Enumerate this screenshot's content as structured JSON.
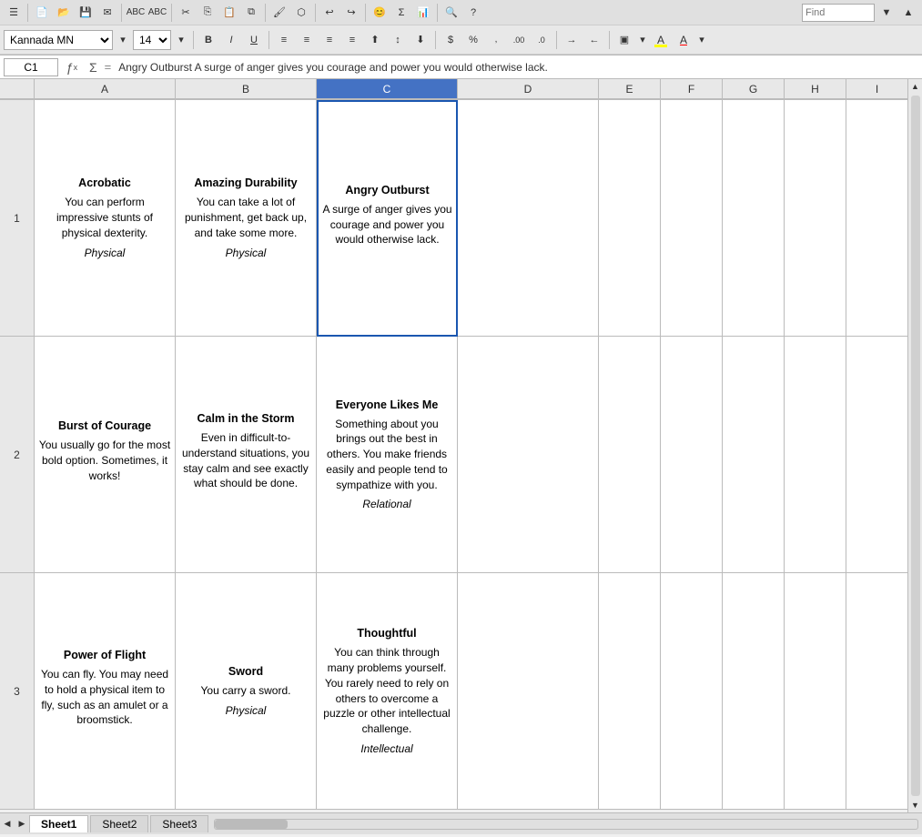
{
  "toolbar": {
    "font_name": "Kannada MN",
    "font_size": "14",
    "bold_label": "B",
    "italic_label": "I",
    "underline_label": "U",
    "find_placeholder": "Find"
  },
  "formula_bar": {
    "cell_ref": "C1",
    "formula_text": "Angry Outburst  A surge of anger gives you courage and power you would otherwise lack."
  },
  "columns": [
    "A",
    "B",
    "C",
    "D",
    "E",
    "F",
    "G",
    "H",
    "I"
  ],
  "rows": [
    {
      "row_num": "1",
      "cells": [
        {
          "title": "Acrobatic",
          "body": "You can perform impressive stunts of physical dexterity.",
          "type": "Physical"
        },
        {
          "title": "Amazing Durability",
          "body": "You can take a lot of punishment, get back up, and take some more.",
          "type": "Physical"
        },
        {
          "title": "Angry Outburst",
          "body": "A surge of anger gives you courage and power you would otherwise lack.",
          "type": ""
        },
        {
          "title": "",
          "body": "",
          "type": ""
        },
        {
          "title": "",
          "body": "",
          "type": ""
        },
        {
          "title": "",
          "body": "",
          "type": ""
        },
        {
          "title": "",
          "body": "",
          "type": ""
        },
        {
          "title": "",
          "body": "",
          "type": ""
        },
        {
          "title": "",
          "body": "",
          "type": ""
        }
      ]
    },
    {
      "row_num": "2",
      "cells": [
        {
          "title": "Burst of Courage",
          "body": "You usually go for the most bold option. Sometimes, it works!",
          "type": ""
        },
        {
          "title": "Calm in the Storm",
          "body": "Even in difficult-to-understand situations, you stay calm and see exactly what should be done.",
          "type": ""
        },
        {
          "title": "Everyone Likes Me",
          "body": "Something about you brings out the best in others. You make friends easily and people tend to sympathize with you.",
          "type": "Relational"
        },
        {
          "title": "",
          "body": "",
          "type": ""
        },
        {
          "title": "",
          "body": "",
          "type": ""
        },
        {
          "title": "",
          "body": "",
          "type": ""
        },
        {
          "title": "",
          "body": "",
          "type": ""
        },
        {
          "title": "",
          "body": "",
          "type": ""
        },
        {
          "title": "",
          "body": "",
          "type": ""
        }
      ]
    },
    {
      "row_num": "3",
      "cells": [
        {
          "title": "Power of Flight",
          "body": "You can fly. You may need to hold a physical item to fly, such as an amulet or a broomstick.",
          "type": ""
        },
        {
          "title": "Sword",
          "body": "You carry a sword.",
          "type": "Physical"
        },
        {
          "title": "Thoughtful",
          "body": "You can think through many problems yourself. You rarely need to rely on others to overcome a puzzle or other intellectual challenge.",
          "type": "Intellectual"
        },
        {
          "title": "",
          "body": "",
          "type": ""
        },
        {
          "title": "",
          "body": "",
          "type": ""
        },
        {
          "title": "",
          "body": "",
          "type": ""
        },
        {
          "title": "",
          "body": "",
          "type": ""
        },
        {
          "title": "",
          "body": "",
          "type": ""
        },
        {
          "title": "",
          "body": "",
          "type": ""
        }
      ]
    }
  ],
  "sheets": [
    "Sheet1",
    "Sheet2",
    "Sheet3"
  ],
  "active_sheet": "Sheet1"
}
